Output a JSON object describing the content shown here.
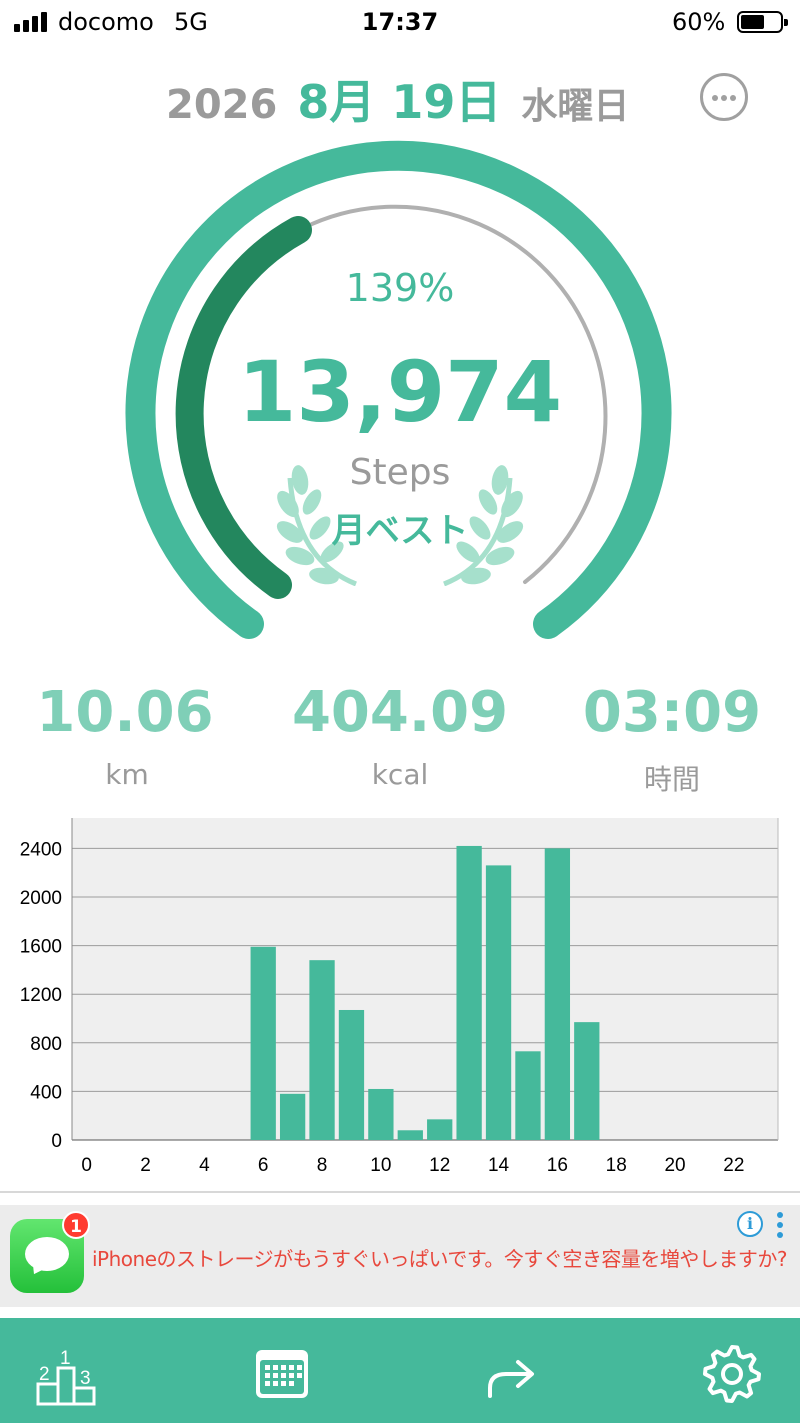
{
  "status_bar": {
    "carrier": "docomo",
    "network": "5G",
    "time": "17:37",
    "battery_percent": "60%",
    "battery_level": 0.6
  },
  "header": {
    "year": "2026",
    "month_day": "8月 19日",
    "weekday": "水曜日",
    "more_icon": "ellipsis-circle-icon"
  },
  "progress": {
    "percent_label": "139%",
    "steps": "13,974",
    "steps_unit": "Steps",
    "badge_label": "月ベスト",
    "badge_icon": "laurel-wreath-icon",
    "colors": {
      "accent": "#45b99b",
      "dark_accent": "#23875e",
      "track": "#b0b0b0",
      "laurel": "#a6e0cc"
    }
  },
  "stats": [
    {
      "value": "10.06",
      "unit": "km"
    },
    {
      "value": "404.09",
      "unit": "kcal"
    },
    {
      "value": "03:09",
      "unit": "時間"
    }
  ],
  "chart_data": {
    "type": "bar",
    "x": [
      0,
      1,
      2,
      3,
      4,
      5,
      6,
      7,
      8,
      9,
      10,
      11,
      12,
      13,
      14,
      15,
      16,
      17,
      18,
      19,
      20,
      21,
      22,
      23
    ],
    "values": [
      0,
      0,
      0,
      0,
      0,
      0,
      1590,
      380,
      1480,
      1070,
      420,
      80,
      170,
      2420,
      2260,
      730,
      2400,
      970,
      0,
      0,
      0,
      0,
      0,
      0
    ],
    "x_ticks": [
      "0",
      "2",
      "4",
      "6",
      "8",
      "10",
      "12",
      "14",
      "16",
      "18",
      "20",
      "22"
    ],
    "y_ticks": [
      "0",
      "400",
      "800",
      "1200",
      "1600",
      "2000",
      "2400"
    ],
    "ylim": [
      0,
      2650
    ],
    "grid": true,
    "bar_color": "#45b99b",
    "background": "#efefef"
  },
  "ad": {
    "app_icon": "messages-app-icon",
    "badge_count": "1",
    "text": "iPhoneのストレージがもうすぐいっぱいです。今すぐ空き容量を増やしますか?",
    "info_icon": "info-icon",
    "menu_icon": "vertical-dots-icon"
  },
  "tab_bar": {
    "background": "#45b99b",
    "tabs": [
      {
        "icon": "ranking-podium-icon",
        "podium_labels": [
          "2",
          "1",
          "3"
        ]
      },
      {
        "icon": "calendar-icon"
      },
      {
        "icon": "share-arrow-icon"
      },
      {
        "icon": "gear-icon"
      }
    ]
  }
}
